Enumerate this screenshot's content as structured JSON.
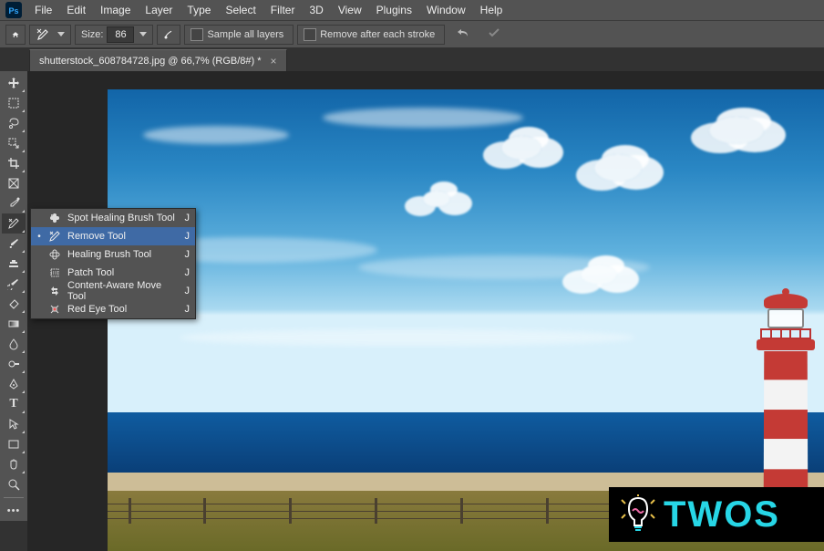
{
  "menu": {
    "items": [
      "File",
      "Edit",
      "Image",
      "Layer",
      "Type",
      "Select",
      "Filter",
      "3D",
      "View",
      "Plugins",
      "Window",
      "Help"
    ]
  },
  "options": {
    "size_label": "Size:",
    "size_value": "86",
    "sample_all_layers": "Sample all layers",
    "remove_after_each_stroke": "Remove after each stroke"
  },
  "tab": {
    "title": "shutterstock_608784728.jpg @ 66,7% (RGB/8#) *"
  },
  "flyout": {
    "items": [
      {
        "label": "Spot Healing Brush Tool",
        "shortcut": "J",
        "selected": false
      },
      {
        "label": "Remove Tool",
        "shortcut": "J",
        "selected": true
      },
      {
        "label": "Healing Brush Tool",
        "shortcut": "J",
        "selected": false
      },
      {
        "label": "Patch Tool",
        "shortcut": "J",
        "selected": false
      },
      {
        "label": "Content-Aware Move Tool",
        "shortcut": "J",
        "selected": false
      },
      {
        "label": "Red Eye Tool",
        "shortcut": "J",
        "selected": false
      }
    ]
  },
  "tools": [
    "move-tool",
    "marquee-tool",
    "lasso-tool",
    "quick-select-tool",
    "crop-tool",
    "frame-tool",
    "eyedropper-tool",
    "healing-tool",
    "brush-tool",
    "clone-stamp-tool",
    "history-brush-tool",
    "eraser-tool",
    "gradient-tool",
    "blur-tool",
    "dodge-tool",
    "pen-tool",
    "type-tool",
    "path-select-tool",
    "rectangle-tool",
    "hand-tool",
    "zoom-tool",
    "edit-toolbar"
  ],
  "watermark": {
    "text": "TWOS"
  },
  "colors": {
    "accent": "#27d6e6",
    "panel": "#535353",
    "workspace": "#262626",
    "lighthouse_red": "#c43a35",
    "lighthouse_white": "#f3f3f3"
  }
}
